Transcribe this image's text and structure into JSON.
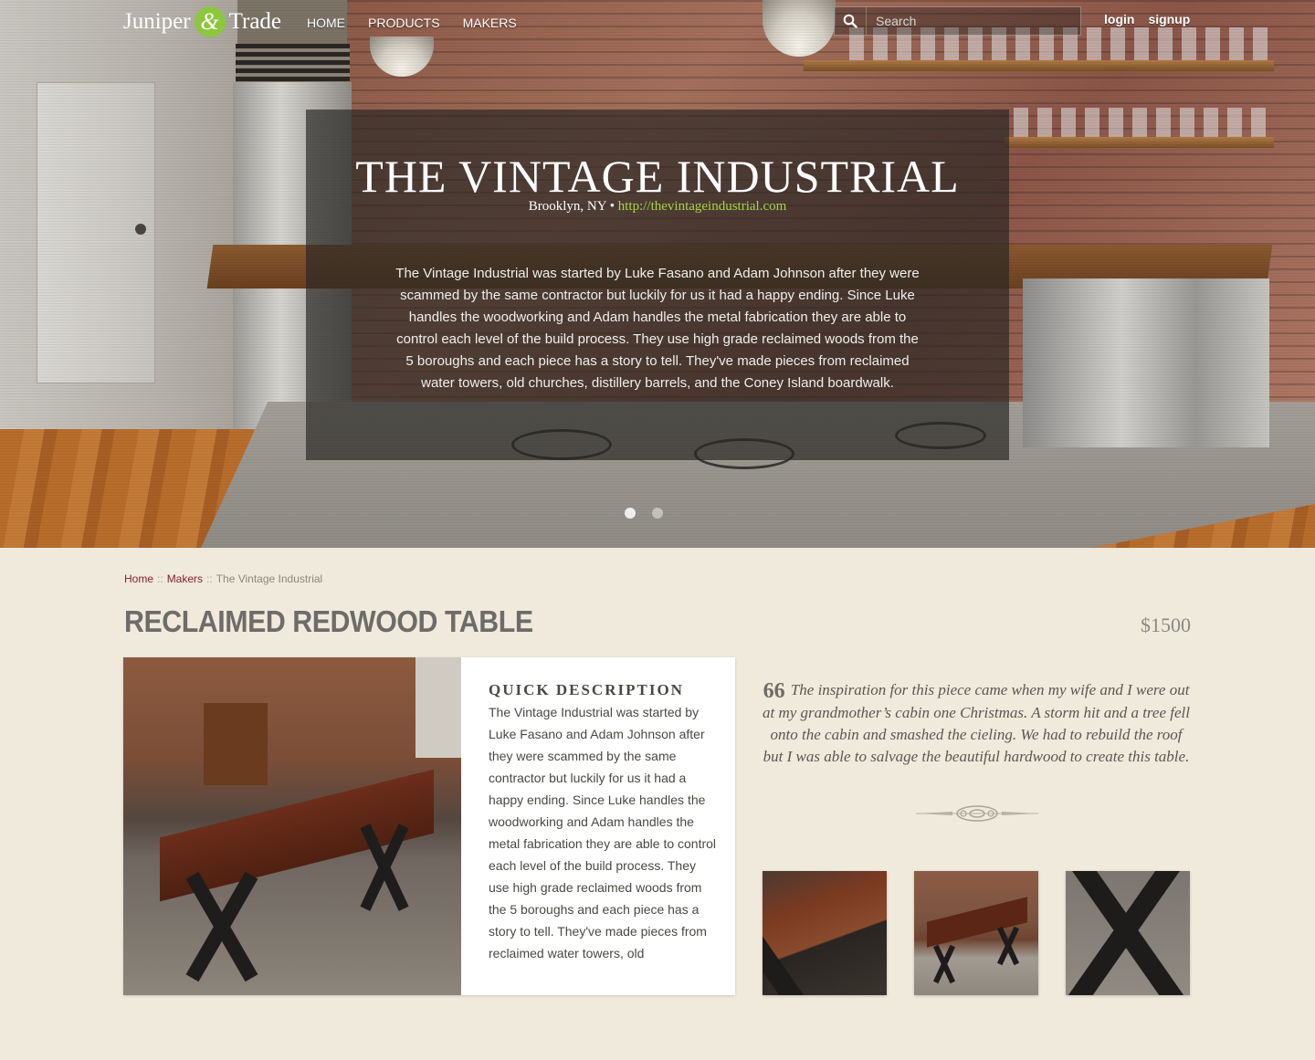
{
  "brand": {
    "left": "Juniper",
    "amp": "&",
    "right": "Trade",
    "accent": "#8dc63f"
  },
  "nav": {
    "items": [
      "HOME",
      "PRODUCTS",
      "MAKERS"
    ]
  },
  "search": {
    "placeholder": "Search",
    "icon": "search-icon"
  },
  "auth": {
    "login": "login",
    "signup": "signup"
  },
  "hero": {
    "title": "THE VINTAGE INDUSTRIAL",
    "location": "Brooklyn, NY",
    "separator": "•",
    "url": "http://thevintageindustrial.com",
    "description": "The Vintage Industrial was started by Luke Fasano and Adam Johnson after they were scammed by the same contractor but luckily for us it had a happy ending. Since Luke handles the woodworking and Adam handles the metal fabrication they are able to control each level of the build process. They use high grade reclaimed woods from the 5 boroughs and each piece has a story to tell. They've made pieces from reclaimed water towers, old churches, distillery barrels, and the Coney Island boardwalk.",
    "slides": 2,
    "active_slide": 1
  },
  "breadcrumb": {
    "home": "Home",
    "sep": "::",
    "makers": "Makers",
    "current": "The Vintage Industrial"
  },
  "product": {
    "title": "RECLAIMED REDWOOD TABLE",
    "price": "$1500",
    "quick_heading": "QUICK DESCRIPTION",
    "quick_text": "The Vintage Industrial was started by Luke Fasano and Adam Johnson after they were scammed by the same contractor but luckily for us it had a happy ending. Since Luke handles the woodworking and Adam handles the metal fabrication they are able to control each level of the build process. They use high grade reclaimed woods from the 5 boroughs and each piece has a story to tell. They've made pieces from reclaimed water towers, old",
    "quote_mark": "66",
    "quote": "The inspiration for this piece came when my wife and I were out at my grandmother’s cabin one Christmas. A storm hit and a tree fell onto the cabin and smashed the cieling. We had to rebuild the roof but I was able to salvage the beautiful hardwood to create this table."
  },
  "colors": {
    "background": "#efeadc",
    "breadcrumb_link": "#8b1f2c",
    "url_green": "#a6d642"
  }
}
